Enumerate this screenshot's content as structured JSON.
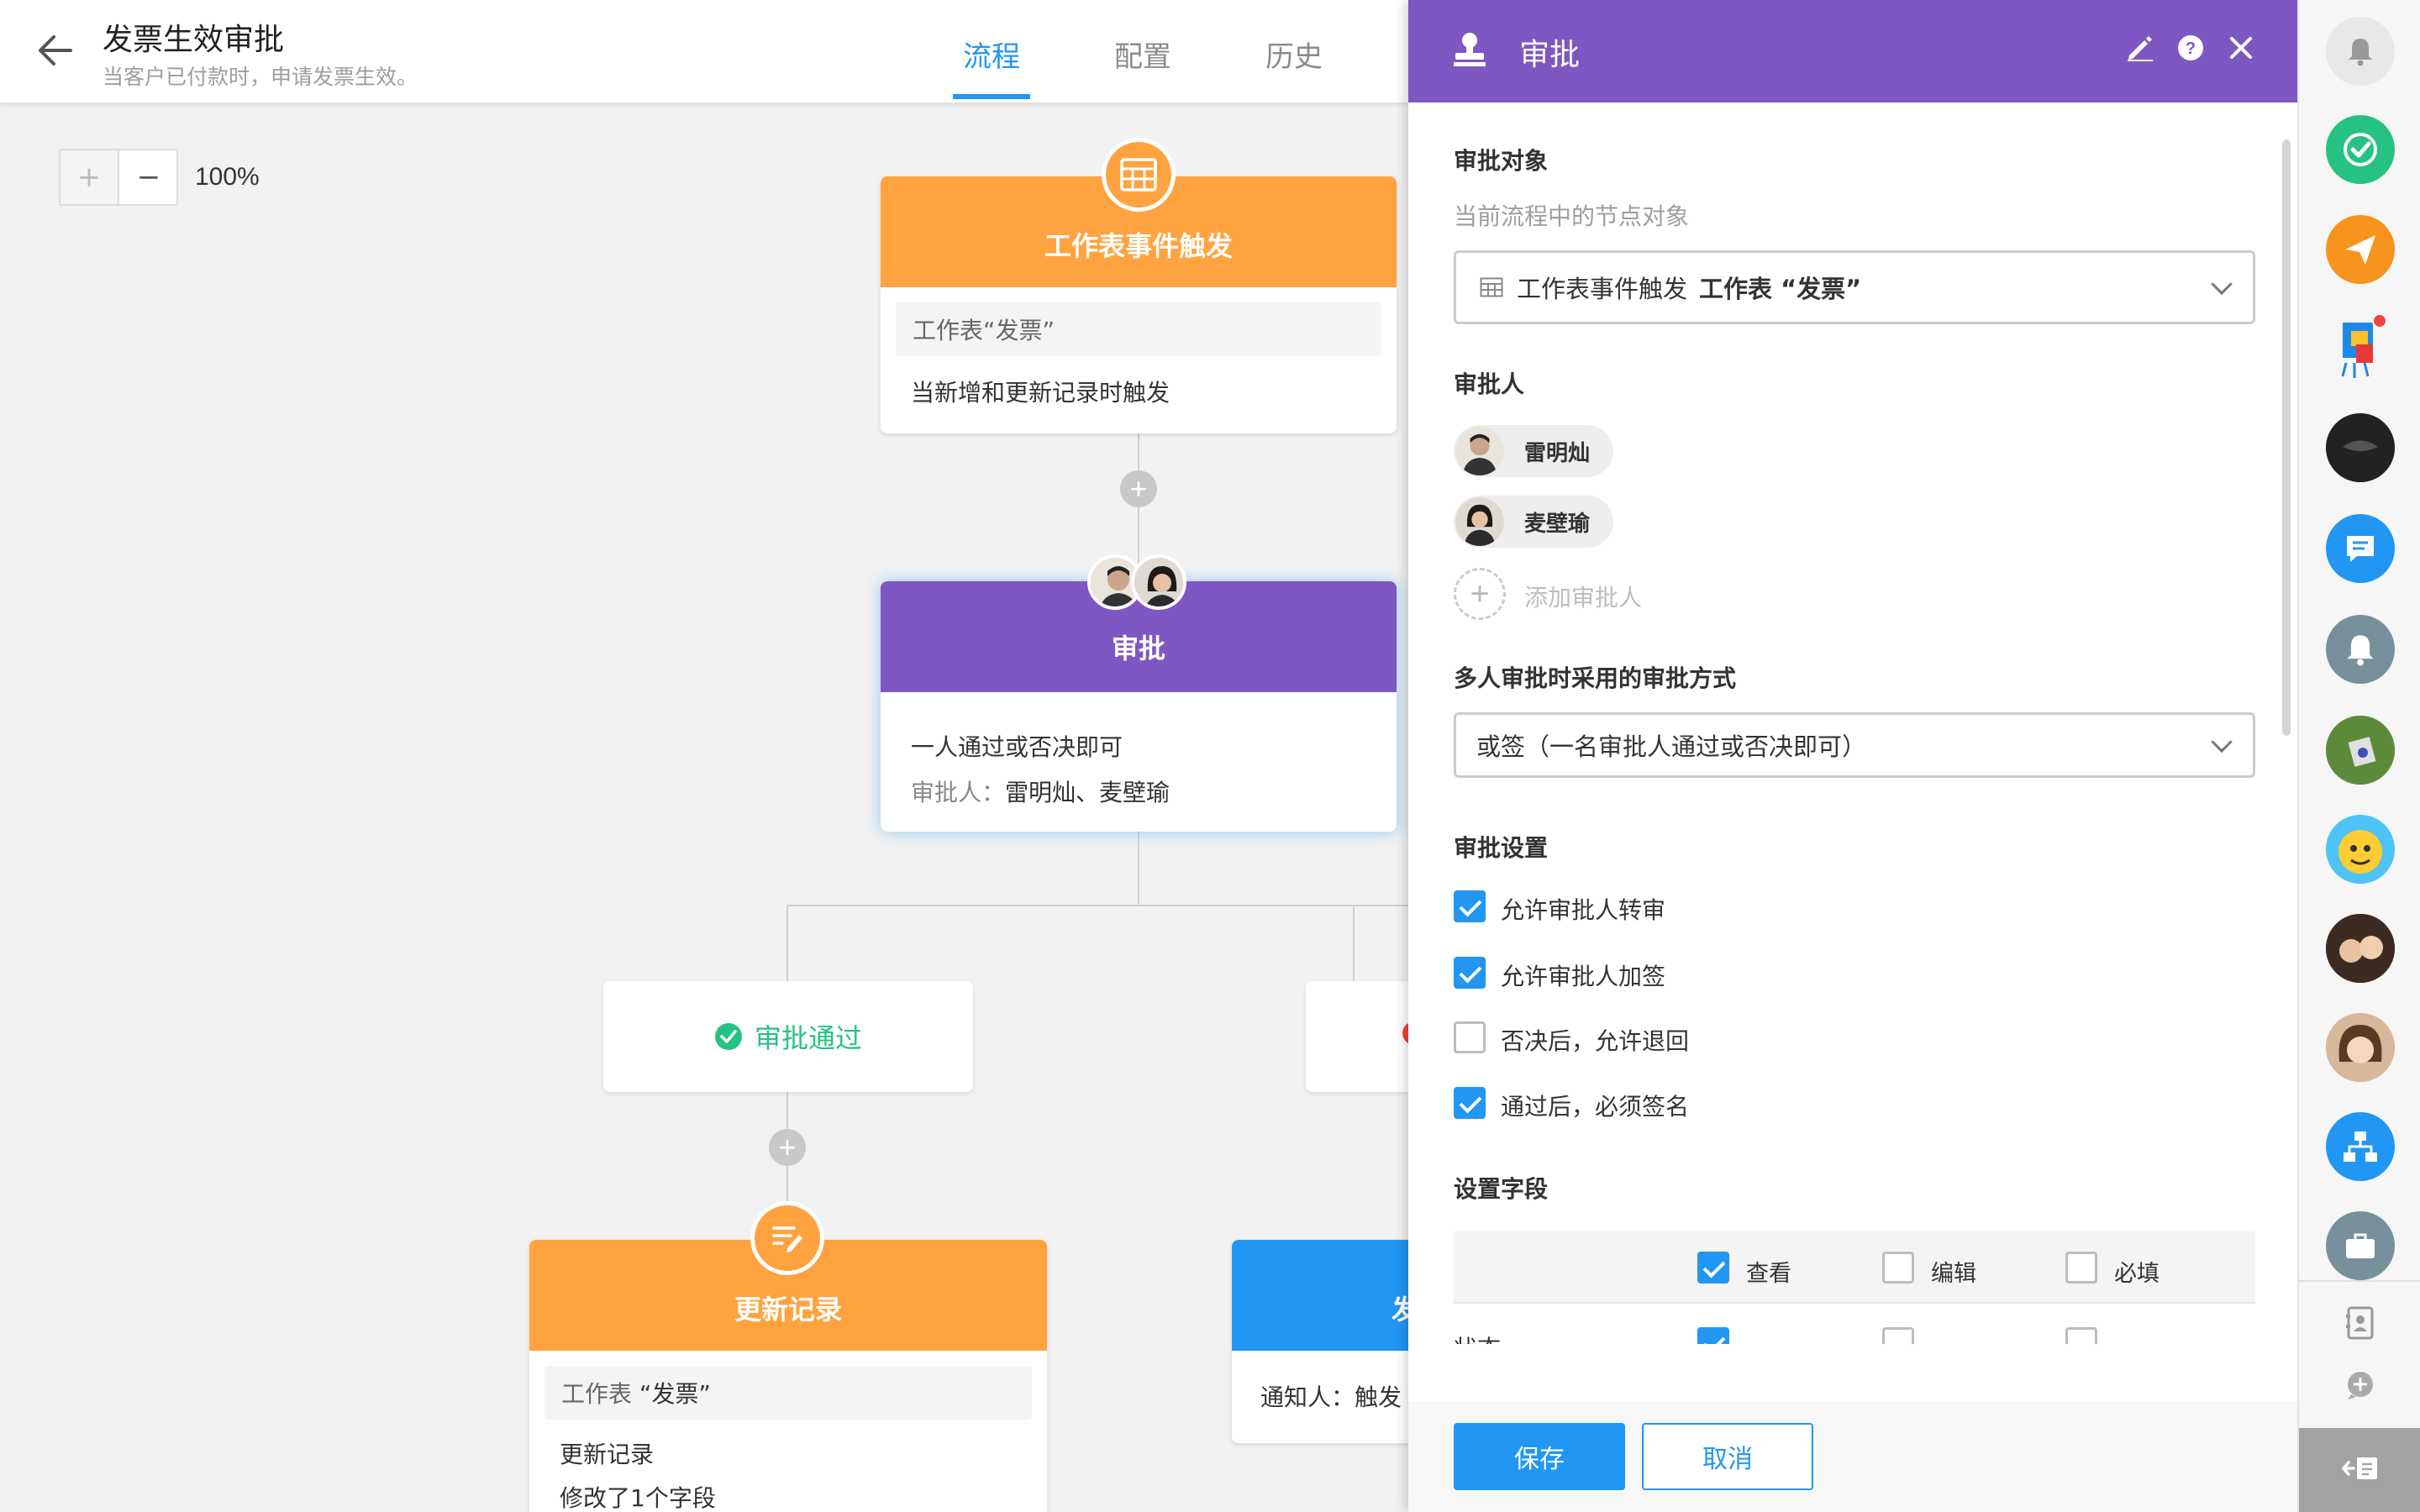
{
  "header": {
    "title": "发票生效审批",
    "description": "当客户已付款时，申请发票生效。",
    "tabs": [
      "流程",
      "配置",
      "历史"
    ],
    "active_tab": "流程"
  },
  "canvas": {
    "zoom_level": "100%",
    "trigger_node": {
      "title": "工作表事件触发",
      "sheet_label": "工作表“发票”",
      "description": "当新增和更新记录时触发"
    },
    "approval_node": {
      "title": "审批",
      "mode": "一人通过或否决即可",
      "approvers_label": "审批人：",
      "approvers": "雷明灿、麦壁瑜"
    },
    "branch_pass": "审批通过",
    "update_node": {
      "title": "更新记录",
      "sheet_prefix": "工作表",
      "sheet_name": "“发票”",
      "line1": "更新记录",
      "line2": "修改了1个字段"
    },
    "notify_node": {
      "title": "发",
      "line": "通知人：触发"
    }
  },
  "panel": {
    "title": "审批",
    "target": {
      "label": "审批对象",
      "hint": "当前流程中的节点对象",
      "value_prefix": "工作表事件触发",
      "value_bold": "工作表 “发票”"
    },
    "approver": {
      "label": "审批人",
      "people": [
        "雷明灿",
        "麦壁瑜"
      ],
      "add_label": "添加审批人"
    },
    "method": {
      "label": "多人审批时采用的审批方式",
      "value": "或签（一名审批人通过或否决即可）"
    },
    "settings": {
      "label": "审批设置",
      "options": [
        {
          "label": "允许审批人转审",
          "checked": true
        },
        {
          "label": "允许审批人加签",
          "checked": true
        },
        {
          "label": "否决后，允许退回",
          "checked": false
        },
        {
          "label": "通过后，必须签名",
          "checked": true
        }
      ]
    },
    "fields": {
      "label": "设置字段",
      "columns": [
        "查看",
        "编辑",
        "必填"
      ],
      "first_row_label": "状态"
    },
    "save_label": "保存",
    "cancel_label": "取消"
  },
  "colors": {
    "primary": "#2196f3",
    "approval_purple": "#7e57c2",
    "trigger_orange": "#ffa340",
    "success_green": "#26c281"
  }
}
